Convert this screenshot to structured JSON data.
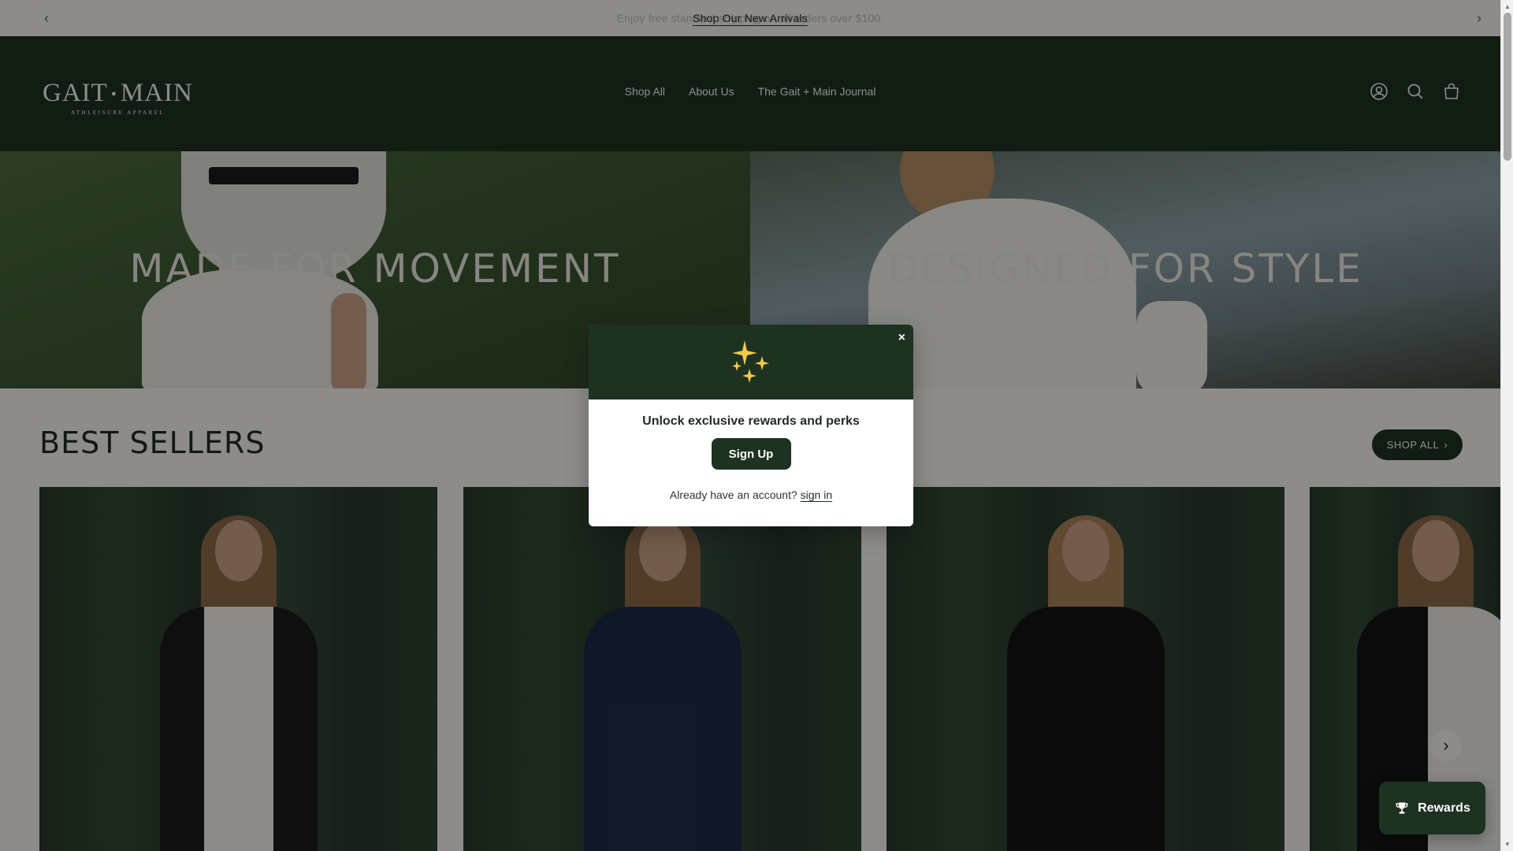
{
  "announcement": {
    "ghost_text": "Enjoy free standard shipping on all orders over $100.",
    "link_text": "Shop Our New Arrivals"
  },
  "header": {
    "logo_word_left": "GAIT",
    "logo_word_right": "MAIN",
    "logo_dot": "•",
    "logo_sub": "ATHLEISURE APPAREL",
    "nav": [
      "Shop All",
      "About Us",
      "The Gait + Main Journal"
    ],
    "icons": [
      "account-icon",
      "search-icon",
      "cart-icon"
    ]
  },
  "hero": {
    "left_title": "MADE FOR MOVEMENT",
    "right_title": "DESIGNED FOR STYLE"
  },
  "best_sellers": {
    "title": "BEST SELLERS",
    "shop_all": "SHOP ALL",
    "shop_all_arrow": "›",
    "next_arrow": "›"
  },
  "modal": {
    "close": "×",
    "heading": "Unlock exclusive rewards and perks",
    "signup_button": "Sign Up",
    "already_text": "Already have an account?",
    "sign_in_link": "sign in"
  },
  "rewards": {
    "label": "Rewards"
  },
  "colors": {
    "brand_green": "#1e3222",
    "cream": "#f3f2ee",
    "sparkle_gold": "#f2c94c"
  }
}
